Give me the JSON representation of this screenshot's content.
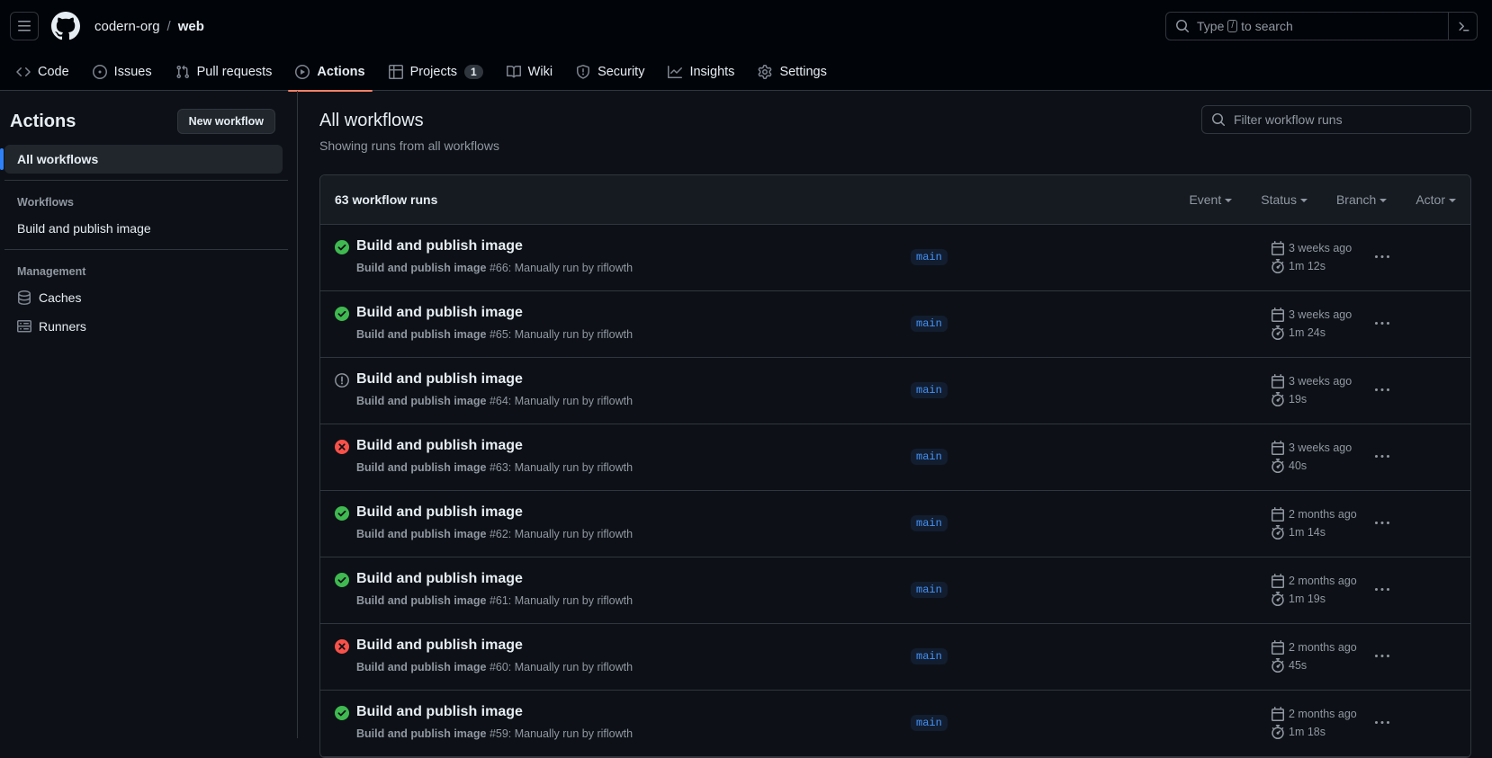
{
  "header": {
    "org": "codern-org",
    "separator": "/",
    "repo": "web",
    "search_prefix": "Type",
    "search_key": "/",
    "search_suffix": "to search"
  },
  "tabs": [
    {
      "label": "Code",
      "icon": "code-icon"
    },
    {
      "label": "Issues",
      "icon": "issue-icon"
    },
    {
      "label": "Pull requests",
      "icon": "pull-request-icon"
    },
    {
      "label": "Actions",
      "icon": "play-icon",
      "active": true
    },
    {
      "label": "Projects",
      "icon": "table-icon",
      "counter": "1"
    },
    {
      "label": "Wiki",
      "icon": "book-icon"
    },
    {
      "label": "Security",
      "icon": "shield-icon"
    },
    {
      "label": "Insights",
      "icon": "graph-icon"
    },
    {
      "label": "Settings",
      "icon": "gear-icon"
    }
  ],
  "sidebar": {
    "title": "Actions",
    "new_workflow": "New workflow",
    "all_workflows": "All workflows",
    "workflows_heading": "Workflows",
    "workflows": [
      "Build and publish image"
    ],
    "management_heading": "Management",
    "caches": "Caches",
    "runners": "Runners"
  },
  "main": {
    "title": "All workflows",
    "subtitle": "Showing runs from all workflows",
    "filter_placeholder": "Filter workflow runs",
    "run_count": "63 workflow runs",
    "filters": [
      "Event",
      "Status",
      "Branch",
      "Actor"
    ]
  },
  "runs": [
    {
      "title": "Build and publish image",
      "workflow": "Build and publish image",
      "detail": "#66: Manually run by riflowth",
      "branch": "main",
      "when": "3 weeks ago",
      "duration": "1m 12s",
      "status": "success"
    },
    {
      "title": "Build and publish image",
      "workflow": "Build and publish image",
      "detail": "#65: Manually run by riflowth",
      "branch": "main",
      "when": "3 weeks ago",
      "duration": "1m 24s",
      "status": "success"
    },
    {
      "title": "Build and publish image",
      "workflow": "Build and publish image",
      "detail": "#64: Manually run by riflowth",
      "branch": "main",
      "when": "3 weeks ago",
      "duration": "19s",
      "status": "cancelled"
    },
    {
      "title": "Build and publish image",
      "workflow": "Build and publish image",
      "detail": "#63: Manually run by riflowth",
      "branch": "main",
      "when": "3 weeks ago",
      "duration": "40s",
      "status": "failure"
    },
    {
      "title": "Build and publish image",
      "workflow": "Build and publish image",
      "detail": "#62: Manually run by riflowth",
      "branch": "main",
      "when": "2 months ago",
      "duration": "1m 14s",
      "status": "success"
    },
    {
      "title": "Build and publish image",
      "workflow": "Build and publish image",
      "detail": "#61: Manually run by riflowth",
      "branch": "main",
      "when": "2 months ago",
      "duration": "1m 19s",
      "status": "success"
    },
    {
      "title": "Build and publish image",
      "workflow": "Build and publish image",
      "detail": "#60: Manually run by riflowth",
      "branch": "main",
      "when": "2 months ago",
      "duration": "45s",
      "status": "failure"
    },
    {
      "title": "Build and publish image",
      "workflow": "Build and publish image",
      "detail": "#59: Manually run by riflowth",
      "branch": "main",
      "when": "2 months ago",
      "duration": "1m 18s",
      "status": "success"
    }
  ],
  "colors": {
    "success": "#3fb950",
    "failure": "#f85149",
    "neutral": "#9198a1",
    "accent": "#f78166"
  }
}
